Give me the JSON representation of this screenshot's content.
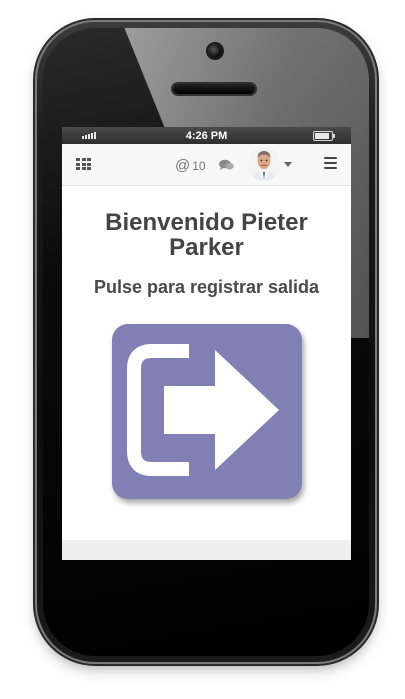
{
  "status_bar": {
    "time": "4:26 PM"
  },
  "navbar": {
    "mentions_symbol": "@",
    "mentions_count": "10",
    "icons": [
      "apps-grid-icon",
      "chat-icon",
      "avatar",
      "chevron-down-icon",
      "menu-icon"
    ]
  },
  "main": {
    "welcome": "Bienvenido Pieter Parker",
    "prompt": "Pulse para registrar salida"
  },
  "colors": {
    "exit_button": "#8080b4",
    "text": "#444444"
  }
}
